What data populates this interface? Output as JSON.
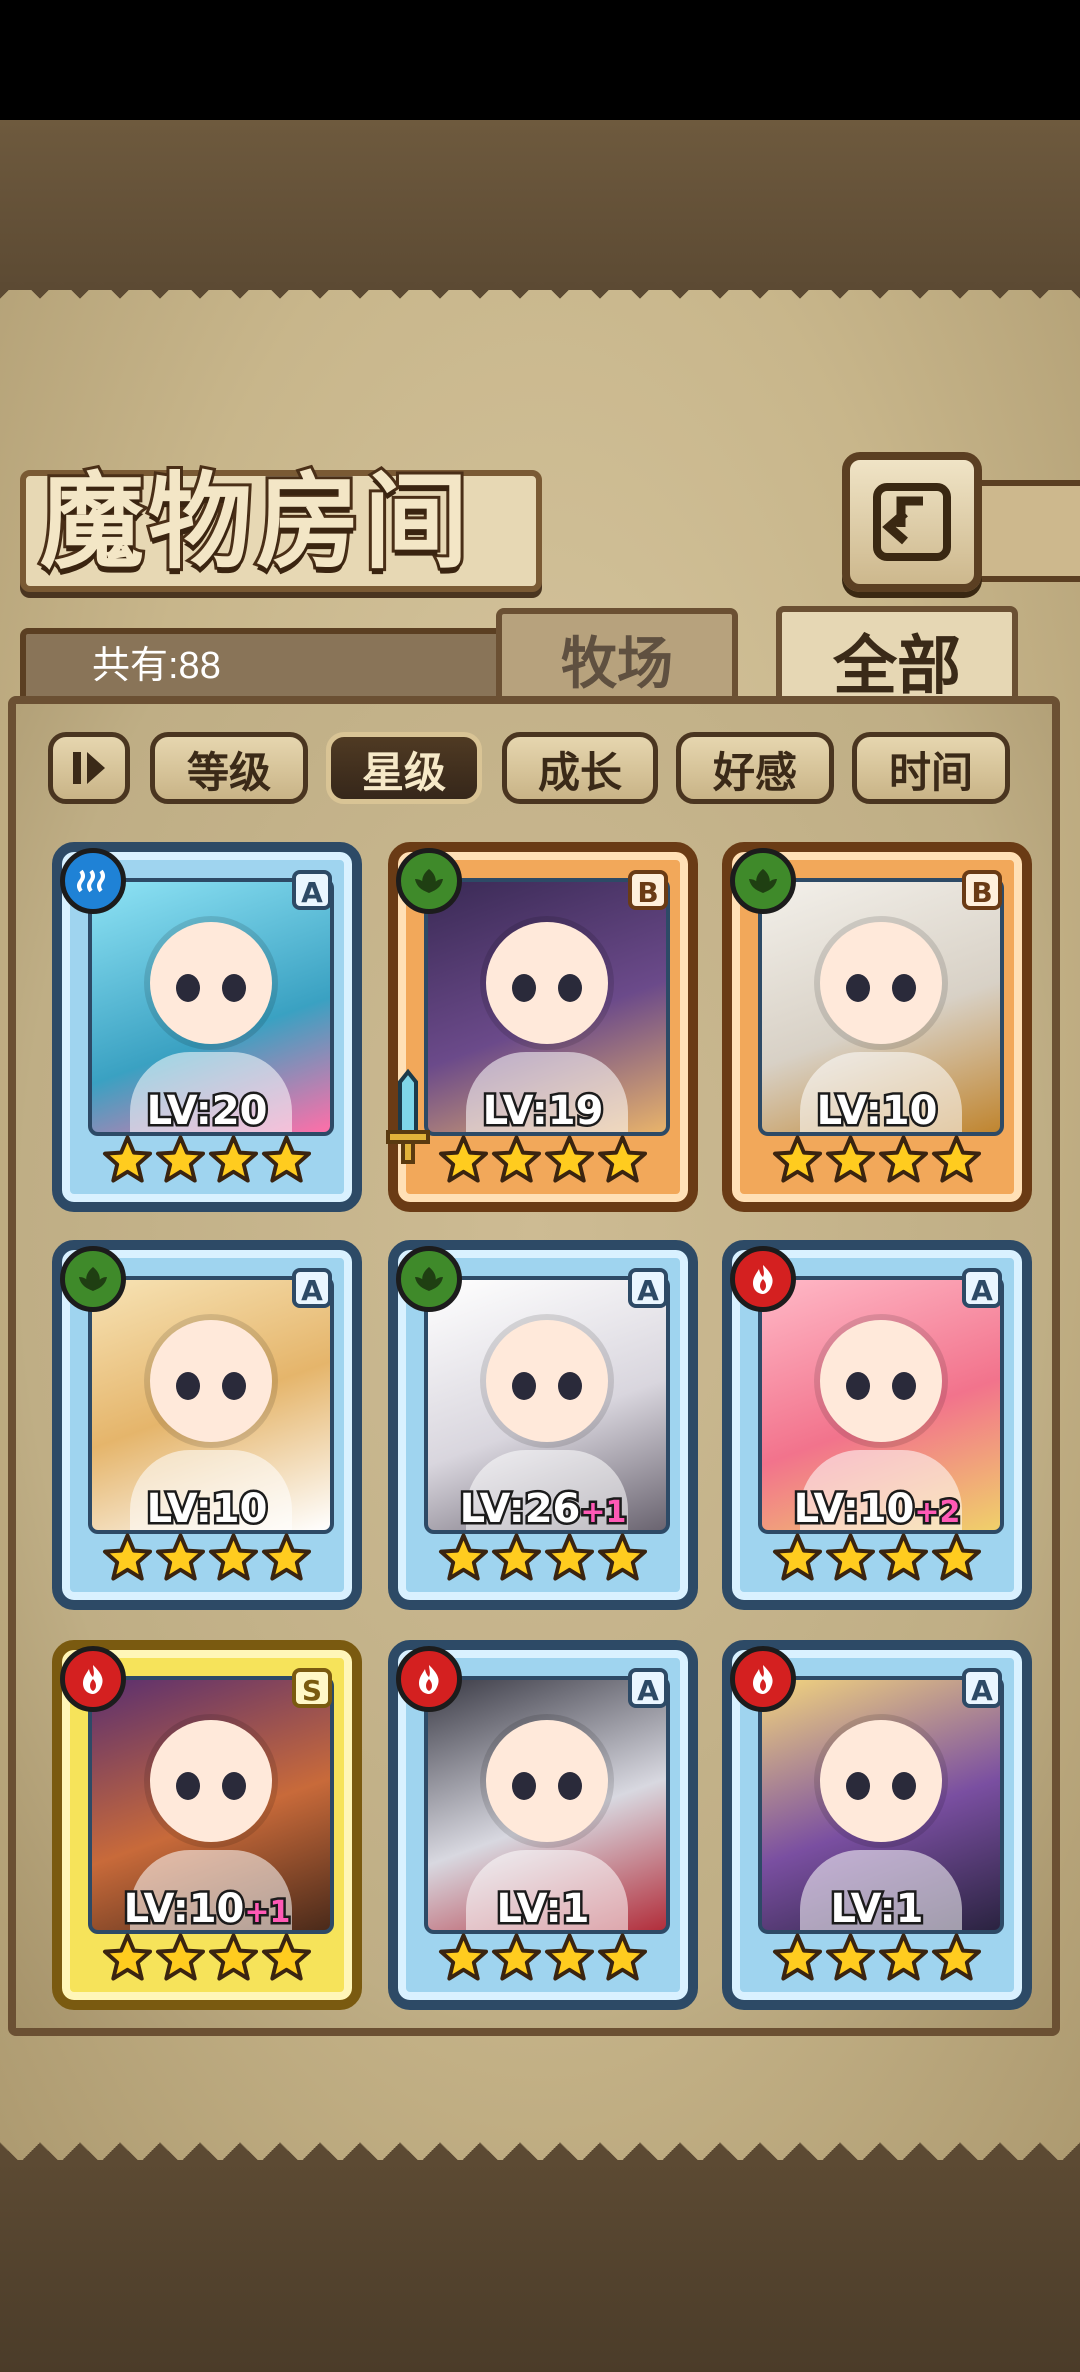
{
  "header": {
    "title": "魔物房间",
    "back_icon": "back-arrow-icon"
  },
  "count": {
    "label": "共有:88"
  },
  "tabs": [
    {
      "label": "牧场",
      "selected": false
    },
    {
      "label": "全部",
      "selected": true
    }
  ],
  "sort": {
    "toggle_icon": "sort-direction-toggle-icon",
    "options": [
      {
        "label": "等级",
        "active": false
      },
      {
        "label": "星级",
        "active": true
      },
      {
        "label": "成长",
        "active": false
      },
      {
        "label": "好感",
        "active": false
      },
      {
        "label": "时间",
        "active": false
      }
    ]
  },
  "monsters": [
    {
      "element": "water",
      "rank": "A",
      "level": "LV:20",
      "bonus": "",
      "stars": 4
    },
    {
      "element": "plant",
      "rank": "B",
      "level": "LV:19",
      "bonus": "",
      "stars": 4,
      "equipped": "sword-icon"
    },
    {
      "element": "plant",
      "rank": "B",
      "level": "LV:10",
      "bonus": "",
      "stars": 4
    },
    {
      "element": "plant",
      "rank": "A",
      "level": "LV:10",
      "bonus": "",
      "stars": 4
    },
    {
      "element": "plant",
      "rank": "A",
      "level": "LV:26",
      "bonus": "+1",
      "stars": 4
    },
    {
      "element": "fire",
      "rank": "A",
      "level": "LV:10",
      "bonus": "+2",
      "stars": 4
    },
    {
      "element": "fire",
      "rank": "S",
      "level": "LV:10",
      "bonus": "+1",
      "stars": 4
    },
    {
      "element": "fire",
      "rank": "A",
      "level": "LV:1",
      "bonus": "",
      "stars": 4
    },
    {
      "element": "fire",
      "rank": "A",
      "level": "LV:1",
      "bonus": "",
      "stars": 4
    }
  ],
  "colors": {
    "water": "#1f82d6",
    "plant": "#3f8a2a",
    "fire": "#d42020",
    "bonus": "#ff59b5",
    "star": "#ffcc1f"
  }
}
